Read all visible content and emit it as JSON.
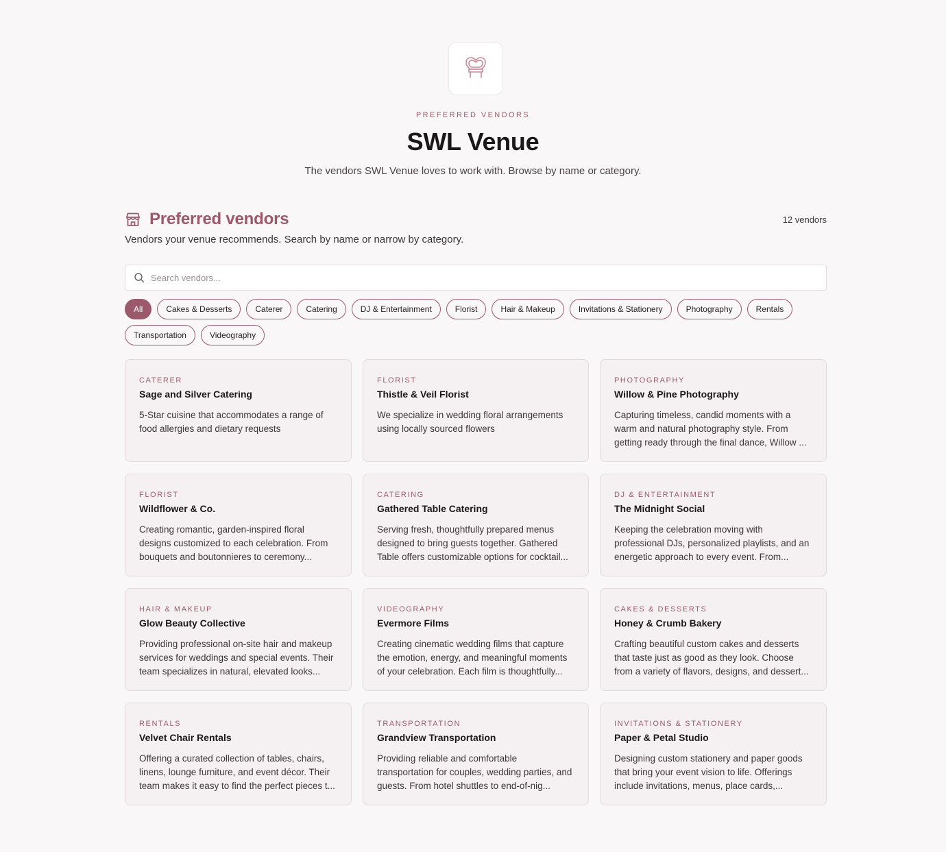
{
  "header": {
    "eyebrow": "PREFERRED VENDORS",
    "title": "SWL Venue",
    "subtitle": "The vendors SWL Venue loves to work with. Browse by name or category."
  },
  "section": {
    "title": "Preferred vendors",
    "count": "12 vendors",
    "subtitle": "Vendors your venue recommends. Search by name or narrow by category."
  },
  "search": {
    "placeholder": "Search vendors...",
    "value": ""
  },
  "filters": [
    "All",
    "Cakes & Desserts",
    "Caterer",
    "Catering",
    "DJ & Entertainment",
    "Florist",
    "Hair & Makeup",
    "Invitations & Stationery",
    "Photography",
    "Rentals",
    "Transportation",
    "Videography"
  ],
  "active_filter": "All",
  "vendors": [
    {
      "category": "Caterer",
      "name": "Sage and Silver Catering",
      "description": "5-Star cuisine that accommodates a range of food allergies and dietary requests"
    },
    {
      "category": "Florist",
      "name": "Thistle & Veil Florist",
      "description": "We specialize in wedding floral arrangements using locally sourced flowers"
    },
    {
      "category": "Photography",
      "name": "Willow & Pine Photography",
      "description": "Capturing timeless, candid moments with a warm and natural photography style. From getting ready through the final dance, Willow ..."
    },
    {
      "category": "Florist",
      "name": "Wildflower & Co.",
      "description": "Creating romantic, garden-inspired floral designs customized to each celebration. From bouquets and boutonnieres to ceremony..."
    },
    {
      "category": "Catering",
      "name": "Gathered Table Catering",
      "description": "Serving fresh, thoughtfully prepared menus designed to bring guests together. Gathered Table offers customizable options for cocktail..."
    },
    {
      "category": "DJ & Entertainment",
      "name": "The Midnight Social",
      "description": "Keeping the celebration moving with professional DJs, personalized playlists, and an energetic approach to every event. From..."
    },
    {
      "category": "Hair & Makeup",
      "name": "Glow Beauty Collective",
      "description": "Providing professional on-site hair and makeup services for weddings and special events. Their team specializes in natural, elevated looks..."
    },
    {
      "category": "Videography",
      "name": "Evermore Films",
      "description": "Creating cinematic wedding films that capture the emotion, energy, and meaningful moments of your celebration. Each film is thoughtfully..."
    },
    {
      "category": "Cakes & Desserts",
      "name": "Honey & Crumb Bakery",
      "description": "Crafting beautiful custom cakes and desserts that taste just as good as they look. Choose from a variety of flavors, designs, and dessert..."
    },
    {
      "category": "Rentals",
      "name": "Velvet Chair Rentals",
      "description": "Offering a curated collection of tables, chairs, linens, lounge furniture, and event décor. Their team makes it easy to find the perfect pieces t..."
    },
    {
      "category": "Transportation",
      "name": "Grandview Transportation",
      "description": "Providing reliable and comfortable transportation for couples, wedding parties, and guests. From hotel shuttles to end-of-nig..."
    },
    {
      "category": "Invitations & Stationery",
      "name": "Paper & Petal Studio",
      "description": "Designing custom stationery and paper goods that bring your event vision to life. Offerings include invitations, menus, place cards,..."
    }
  ],
  "icons": {
    "logo": "heart-chair-icon",
    "section": "storefront-icon",
    "search": "search-icon"
  },
  "colors": {
    "accent": "#9a5a6b",
    "background": "#faf7f8",
    "card": "#f5f1f2"
  }
}
